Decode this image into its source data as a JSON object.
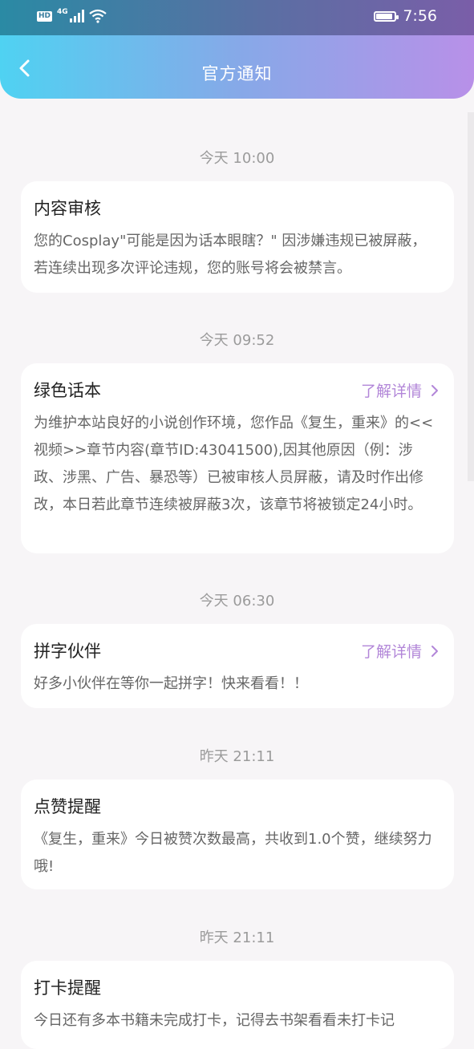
{
  "status_bar": {
    "hd": "HD",
    "network": "4G",
    "time": "7:56"
  },
  "header": {
    "title": "官方通知",
    "back_icon": "chevron-left-icon"
  },
  "colors": {
    "accent_start": "#4fd2f2",
    "accent_end": "#b890e8",
    "link": "#b286d8"
  },
  "notifications": [
    {
      "time": "今天 10:00",
      "title": "内容审核",
      "body": "您的Cosplay\"可能是因为话本眼瞎？\" 因涉嫌违规已被屏蔽，若连续出现多次评论违规，您的账号将会被禁言。"
    },
    {
      "time": "今天 09:52",
      "title": "绿色话本",
      "link": "了解详情",
      "body": "为维护本站良好的小说创作环境，您作品《复生，重来》的<<视频>>章节内容(章节ID:43041500),因其他原因（例：涉政、涉黑、广告、暴恐等）已被审核人员屏蔽，请及时作出修改，本日若此章节连续被屏蔽3次，该章节将被锁定24小时。"
    },
    {
      "time": "今天 06:30",
      "title": "拼字伙伴",
      "link": "了解详情",
      "body": "好多小伙伴在等你一起拼字！快来看看！！"
    },
    {
      "time": "昨天 21:11",
      "title": "点赞提醒",
      "body": "《复生，重来》今日被赞次数最高，共收到1.0个赞，继续努力哦!"
    },
    {
      "time": "昨天 21:11",
      "title": "打卡提醒",
      "body": "今日还有多本书籍未完成打卡，记得去书架看看未打卡记"
    }
  ]
}
